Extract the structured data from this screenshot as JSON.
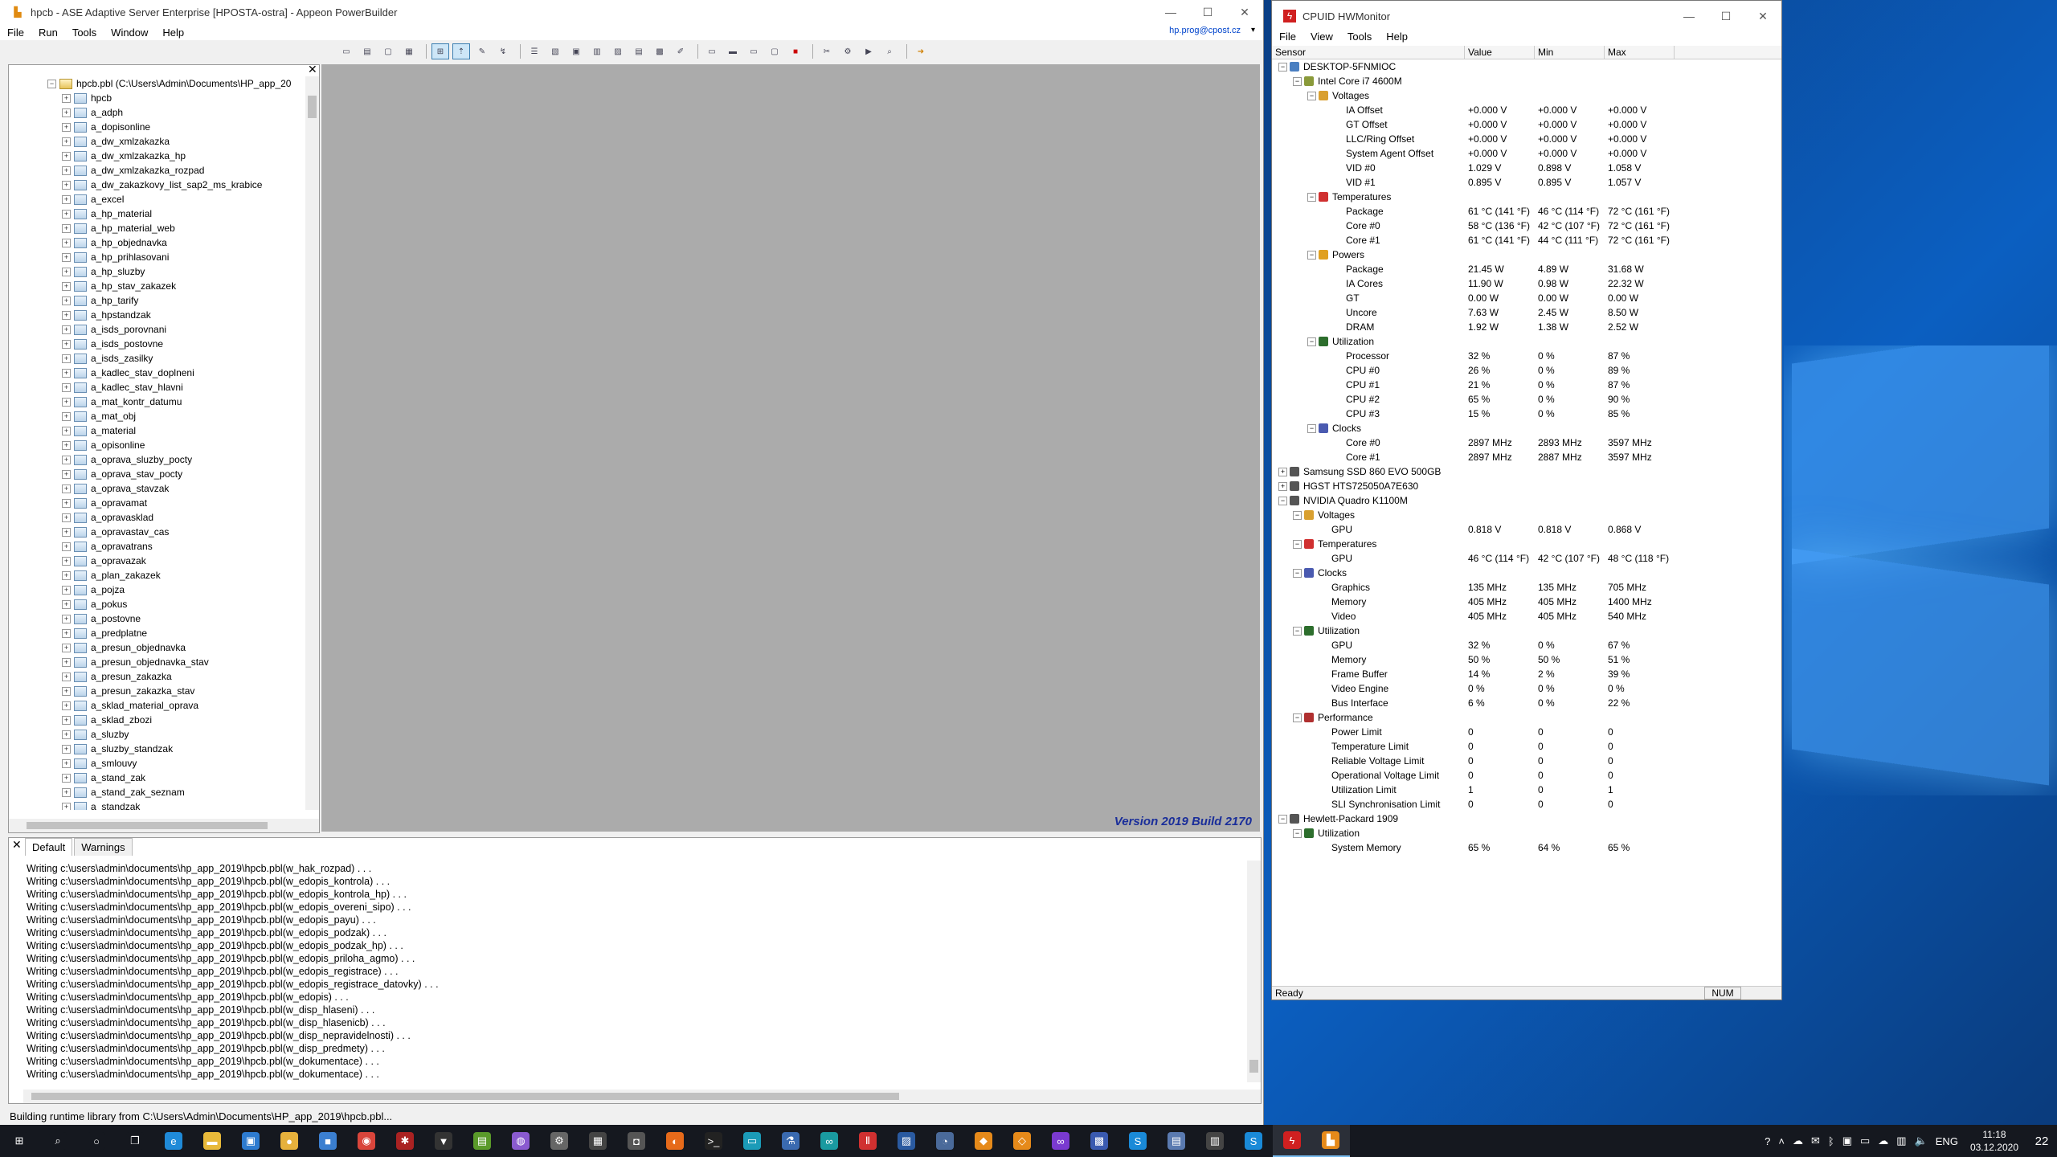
{
  "pb": {
    "title": "hpcb - ASE Adaptive Server Enterprise [HPOSTA-ostra] - Appeon PowerBuilder",
    "menu": [
      "File",
      "Run",
      "Tools",
      "Window",
      "Help"
    ],
    "user": "hp.prog@cpost.cz",
    "root": "hpcb.pbl (C:\\Users\\Admin\\Documents\\HP_app_20",
    "tree": [
      "hpcb",
      "a_adph",
      "a_dopisonline",
      "a_dw_xmlzakazka",
      "a_dw_xmlzakazka_hp",
      "a_dw_xmlzakazka_rozpad",
      "a_dw_zakazkovy_list_sap2_ms_krabice",
      "a_excel",
      "a_hp_material",
      "a_hp_material_web",
      "a_hp_objednavka",
      "a_hp_prihlasovani",
      "a_hp_sluzby",
      "a_hp_stav_zakazek",
      "a_hp_tarify",
      "a_hpstandzak",
      "a_isds_porovnani",
      "a_isds_postovne",
      "a_isds_zasilky",
      "a_kadlec_stav_doplneni",
      "a_kadlec_stav_hlavni",
      "a_mat_kontr_datumu",
      "a_mat_obj",
      "a_material",
      "a_opisonline",
      "a_oprava_sluzby_pocty",
      "a_oprava_stav_pocty",
      "a_oprava_stavzak",
      "a_opravamat",
      "a_opravasklad",
      "a_opravastav_cas",
      "a_opravatrans",
      "a_opravazak",
      "a_plan_zakazek",
      "a_pojza",
      "a_pokus",
      "a_postovne",
      "a_predplatne",
      "a_presun_objednavka",
      "a_presun_objednavka_stav",
      "a_presun_zakazka",
      "a_presun_zakazka_stav",
      "a_sklad_material_oprava",
      "a_sklad_zbozi",
      "a_sluzby",
      "a_sluzby_standzak",
      "a_smlouvy",
      "a_stand_zak",
      "a_stand_zak_seznam",
      "a_standzak"
    ],
    "version": "Version 2019 Build 2170",
    "tabs": [
      "Default",
      "Warnings"
    ],
    "output": [
      "Writing c:\\users\\admin\\documents\\hp_app_2019\\hpcb.pbl(w_hak_rozpad) . . .",
      "Writing c:\\users\\admin\\documents\\hp_app_2019\\hpcb.pbl(w_edopis_kontrola) . . .",
      "Writing c:\\users\\admin\\documents\\hp_app_2019\\hpcb.pbl(w_edopis_kontrola_hp) . . .",
      "Writing c:\\users\\admin\\documents\\hp_app_2019\\hpcb.pbl(w_edopis_overeni_sipo) . . .",
      "Writing c:\\users\\admin\\documents\\hp_app_2019\\hpcb.pbl(w_edopis_payu) . . .",
      "Writing c:\\users\\admin\\documents\\hp_app_2019\\hpcb.pbl(w_edopis_podzak) . . .",
      "Writing c:\\users\\admin\\documents\\hp_app_2019\\hpcb.pbl(w_edopis_podzak_hp) . . .",
      "Writing c:\\users\\admin\\documents\\hp_app_2019\\hpcb.pbl(w_edopis_priloha_agmo) . . .",
      "Writing c:\\users\\admin\\documents\\hp_app_2019\\hpcb.pbl(w_edopis_registrace) . . .",
      "Writing c:\\users\\admin\\documents\\hp_app_2019\\hpcb.pbl(w_edopis_registrace_datovky) . . .",
      "Writing c:\\users\\admin\\documents\\hp_app_2019\\hpcb.pbl(w_edopis) . . .",
      "Writing c:\\users\\admin\\documents\\hp_app_2019\\hpcb.pbl(w_disp_hlaseni) . . .",
      "Writing c:\\users\\admin\\documents\\hp_app_2019\\hpcb.pbl(w_disp_hlasenicb) . . .",
      "Writing c:\\users\\admin\\documents\\hp_app_2019\\hpcb.pbl(w_disp_nepravidelnosti) . . .",
      "Writing c:\\users\\admin\\documents\\hp_app_2019\\hpcb.pbl(w_disp_predmety) . . .",
      "Writing c:\\users\\admin\\documents\\hp_app_2019\\hpcb.pbl(w_dokumentace) . . .",
      "Writing c:\\users\\admin\\documents\\hp_app_2019\\hpcb.pbl(w_dokumentace) . . ."
    ],
    "status": "Building runtime library from C:\\Users\\Admin\\Documents\\HP_app_2019\\hpcb.pbl..."
  },
  "hw": {
    "title": "CPUID HWMonitor",
    "menu": [
      "File",
      "View",
      "Tools",
      "Help"
    ],
    "cols": [
      "Sensor",
      "Value",
      "Min",
      "Max"
    ],
    "rows": [
      {
        "level": 0,
        "pm": "-",
        "label": "DESKTOP-5FNMIOC",
        "icon": "computer-icon",
        "color": "#4a7fc1"
      },
      {
        "level": 1,
        "pm": "-",
        "label": "Intel Core i7 4600M",
        "icon": "cpu-icon",
        "color": "#8a9a3a"
      },
      {
        "level": 2,
        "pm": "-",
        "label": "Voltages",
        "icon": "voltage-icon",
        "color": "#d9a030"
      },
      {
        "level": 3,
        "label": "IA Offset",
        "v": "+0.000 V",
        "mn": "+0.000 V",
        "mx": "+0.000 V"
      },
      {
        "level": 3,
        "label": "GT Offset",
        "v": "+0.000 V",
        "mn": "+0.000 V",
        "mx": "+0.000 V"
      },
      {
        "level": 3,
        "label": "LLC/Ring Offset",
        "v": "+0.000 V",
        "mn": "+0.000 V",
        "mx": "+0.000 V"
      },
      {
        "level": 3,
        "label": "System Agent Offset",
        "v": "+0.000 V",
        "mn": "+0.000 V",
        "mx": "+0.000 V"
      },
      {
        "level": 3,
        "label": "VID #0",
        "v": "1.029 V",
        "mn": "0.898 V",
        "mx": "1.058 V"
      },
      {
        "level": 3,
        "label": "VID #1",
        "v": "0.895 V",
        "mn": "0.895 V",
        "mx": "1.057 V"
      },
      {
        "level": 2,
        "pm": "-",
        "label": "Temperatures",
        "icon": "thermometer-icon",
        "color": "#d03030"
      },
      {
        "level": 3,
        "label": "Package",
        "v": "61 °C  (141 °F)",
        "mn": "46 °C  (114 °F)",
        "mx": "72 °C  (161 °F)"
      },
      {
        "level": 3,
        "label": "Core #0",
        "v": "58 °C  (136 °F)",
        "mn": "42 °C  (107 °F)",
        "mx": "72 °C  (161 °F)"
      },
      {
        "level": 3,
        "label": "Core #1",
        "v": "61 °C  (141 °F)",
        "mn": "44 °C  (111 °F)",
        "mx": "72 °C  (161 °F)"
      },
      {
        "level": 2,
        "pm": "-",
        "label": "Powers",
        "icon": "power-icon",
        "color": "#e0a020"
      },
      {
        "level": 3,
        "label": "Package",
        "v": "21.45 W",
        "mn": "4.89 W",
        "mx": "31.68 W"
      },
      {
        "level": 3,
        "label": "IA Cores",
        "v": "11.90 W",
        "mn": "0.98 W",
        "mx": "22.32 W"
      },
      {
        "level": 3,
        "label": "GT",
        "v": "0.00 W",
        "mn": "0.00 W",
        "mx": "0.00 W"
      },
      {
        "level": 3,
        "label": "Uncore",
        "v": "7.63 W",
        "mn": "2.45 W",
        "mx": "8.50 W"
      },
      {
        "level": 3,
        "label": "DRAM",
        "v": "1.92 W",
        "mn": "1.38 W",
        "mx": "2.52 W"
      },
      {
        "level": 2,
        "pm": "-",
        "label": "Utilization",
        "icon": "utilization-icon",
        "color": "#2d6e2d"
      },
      {
        "level": 3,
        "label": "Processor",
        "v": "32 %",
        "mn": "0 %",
        "mx": "87 %"
      },
      {
        "level": 3,
        "label": "CPU #0",
        "v": "26 %",
        "mn": "0 %",
        "mx": "89 %"
      },
      {
        "level": 3,
        "label": "CPU #1",
        "v": "21 %",
        "mn": "0 %",
        "mx": "87 %"
      },
      {
        "level": 3,
        "label": "CPU #2",
        "v": "65 %",
        "mn": "0 %",
        "mx": "90 %"
      },
      {
        "level": 3,
        "label": "CPU #3",
        "v": "15 %",
        "mn": "0 %",
        "mx": "85 %"
      },
      {
        "level": 2,
        "pm": "-",
        "label": "Clocks",
        "icon": "clock-icon",
        "color": "#4a5ab0"
      },
      {
        "level": 3,
        "label": "Core #0",
        "v": "2897 MHz",
        "mn": "2893 MHz",
        "mx": "3597 MHz"
      },
      {
        "level": 3,
        "label": "Core #1",
        "v": "2897 MHz",
        "mn": "2887 MHz",
        "mx": "3597 MHz"
      },
      {
        "level": 0,
        "pm": "+",
        "label": "Samsung SSD 860 EVO 500GB",
        "icon": "drive-icon",
        "color": "#555"
      },
      {
        "level": 0,
        "pm": "+",
        "label": "HGST HTS725050A7E630",
        "icon": "drive-icon",
        "color": "#555"
      },
      {
        "level": 0,
        "pm": "-",
        "label": "NVIDIA Quadro K1100M",
        "icon": "gpu-icon",
        "color": "#555"
      },
      {
        "level": 1,
        "pm": "-",
        "label": "Voltages",
        "icon": "voltage-icon",
        "color": "#d9a030"
      },
      {
        "level": 2,
        "label": "GPU",
        "v": "0.818 V",
        "mn": "0.818 V",
        "mx": "0.868 V"
      },
      {
        "level": 1,
        "pm": "-",
        "label": "Temperatures",
        "icon": "thermometer-icon",
        "color": "#d03030"
      },
      {
        "level": 2,
        "label": "GPU",
        "v": "46 °C  (114 °F)",
        "mn": "42 °C  (107 °F)",
        "mx": "48 °C  (118 °F)"
      },
      {
        "level": 1,
        "pm": "-",
        "label": "Clocks",
        "icon": "clock-icon",
        "color": "#4a5ab0"
      },
      {
        "level": 2,
        "label": "Graphics",
        "v": "135 MHz",
        "mn": "135 MHz",
        "mx": "705 MHz"
      },
      {
        "level": 2,
        "label": "Memory",
        "v": "405 MHz",
        "mn": "405 MHz",
        "mx": "1400 MHz"
      },
      {
        "level": 2,
        "label": "Video",
        "v": "405 MHz",
        "mn": "405 MHz",
        "mx": "540 MHz"
      },
      {
        "level": 1,
        "pm": "-",
        "label": "Utilization",
        "icon": "utilization-icon",
        "color": "#2d6e2d"
      },
      {
        "level": 2,
        "label": "GPU",
        "v": "32 %",
        "mn": "0 %",
        "mx": "67 %"
      },
      {
        "level": 2,
        "label": "Memory",
        "v": "50 %",
        "mn": "50 %",
        "mx": "51 %"
      },
      {
        "level": 2,
        "label": "Frame Buffer",
        "v": "14 %",
        "mn": "2 %",
        "mx": "39 %"
      },
      {
        "level": 2,
        "label": "Video Engine",
        "v": "0 %",
        "mn": "0 %",
        "mx": "0 %"
      },
      {
        "level": 2,
        "label": "Bus Interface",
        "v": "6 %",
        "mn": "0 %",
        "mx": "22 %"
      },
      {
        "level": 1,
        "pm": "-",
        "label": "Performance",
        "icon": "performance-icon",
        "color": "#b03030"
      },
      {
        "level": 2,
        "label": "Power Limit",
        "v": "0",
        "mn": "0",
        "mx": "0"
      },
      {
        "level": 2,
        "label": "Temperature Limit",
        "v": "0",
        "mn": "0",
        "mx": "0"
      },
      {
        "level": 2,
        "label": "Reliable Voltage Limit",
        "v": "0",
        "mn": "0",
        "mx": "0"
      },
      {
        "level": 2,
        "label": "Operational Voltage Limit",
        "v": "0",
        "mn": "0",
        "mx": "0"
      },
      {
        "level": 2,
        "label": "Utilization Limit",
        "v": "1",
        "mn": "0",
        "mx": "1"
      },
      {
        "level": 2,
        "label": "SLI Synchronisation Limit",
        "v": "0",
        "mn": "0",
        "mx": "0"
      },
      {
        "level": 0,
        "pm": "-",
        "label": "Hewlett-Packard 1909",
        "icon": "motherboard-icon",
        "color": "#555"
      },
      {
        "level": 1,
        "pm": "-",
        "label": "Utilization",
        "icon": "utilization-icon",
        "color": "#2d6e2d"
      },
      {
        "level": 2,
        "label": "System Memory",
        "v": "65 %",
        "mn": "64 %",
        "mx": "65 %"
      }
    ],
    "status": "Ready",
    "num": "NUM"
  },
  "taskbar": {
    "apps": [
      {
        "icon": "start-icon",
        "color": "#15181f",
        "glyph": "⊞"
      },
      {
        "icon": "search-icon",
        "color": "#15181f",
        "glyph": "⌕"
      },
      {
        "icon": "cortana-icon",
        "color": "#15181f",
        "glyph": "○"
      },
      {
        "icon": "task-view-icon",
        "color": "#15181f",
        "glyph": "❐"
      },
      {
        "icon": "edge-icon",
        "color": "#1f8ad8",
        "glyph": "e"
      },
      {
        "icon": "explorer-icon",
        "color": "#e8b93a",
        "glyph": "▬"
      },
      {
        "icon": "store-icon",
        "color": "#2d7bd0",
        "glyph": "▣"
      },
      {
        "icon": "app-icon",
        "color": "#e6b13c",
        "glyph": "●"
      },
      {
        "icon": "app-icon",
        "color": "#3b7fd0",
        "glyph": "■"
      },
      {
        "icon": "chrome-icon",
        "color": "#d9453b",
        "glyph": "◉"
      },
      {
        "icon": "app-icon",
        "color": "#a22",
        "glyph": "✱"
      },
      {
        "icon": "app-icon",
        "color": "#333",
        "glyph": "▼"
      },
      {
        "icon": "app-icon",
        "color": "#5a9a2a",
        "glyph": "▤"
      },
      {
        "icon": "app-icon",
        "color": "#8a5ad0",
        "glyph": "◍"
      },
      {
        "icon": "app-icon",
        "color": "#666",
        "glyph": "⚙"
      },
      {
        "icon": "calculator-icon",
        "color": "#444",
        "glyph": "▦"
      },
      {
        "icon": "camera-icon",
        "color": "#555",
        "glyph": "◘"
      },
      {
        "icon": "firefox-icon",
        "color": "#e66a1a",
        "glyph": "◐"
      },
      {
        "icon": "terminal-icon",
        "color": "#222",
        "glyph": ">_"
      },
      {
        "icon": "app-icon",
        "color": "#1b9bb8",
        "glyph": "▭"
      },
      {
        "icon": "app-icon",
        "color": "#3a6ab0",
        "glyph": "⚗"
      },
      {
        "icon": "arduino-icon",
        "color": "#1a9aa0",
        "glyph": "∞"
      },
      {
        "icon": "app-icon",
        "color": "#d03030",
        "glyph": "Ⅱ"
      },
      {
        "icon": "app-icon",
        "color": "#2a5aa0",
        "glyph": "▨"
      },
      {
        "icon": "app-icon",
        "color": "#4a6a9a",
        "glyph": "◔"
      },
      {
        "icon": "app-icon",
        "color": "#e68a1a",
        "glyph": "◆"
      },
      {
        "icon": "app-icon",
        "color": "#e68a1a",
        "glyph": "◇"
      },
      {
        "icon": "visual-studio-icon",
        "color": "#7a3ad0",
        "glyph": "∞"
      },
      {
        "icon": "app-icon",
        "color": "#3a5ab0",
        "glyph": "▩"
      },
      {
        "icon": "skype-icon",
        "color": "#1a8ad8",
        "glyph": "S"
      },
      {
        "icon": "app-icon",
        "color": "#5a7ab0",
        "glyph": "▤"
      },
      {
        "icon": "app-icon",
        "color": "#444",
        "glyph": "▥"
      },
      {
        "icon": "skype-icon",
        "color": "#1a8ad8",
        "glyph": "S"
      },
      {
        "icon": "hwmonitor-icon",
        "color": "#d02020",
        "glyph": "ϟ"
      },
      {
        "icon": "powerbuilder-icon",
        "color": "#e68a1a",
        "glyph": "▙"
      }
    ],
    "lang": "ENG",
    "time": "11:18",
    "date": "03.12.2020",
    "notif": "22"
  }
}
